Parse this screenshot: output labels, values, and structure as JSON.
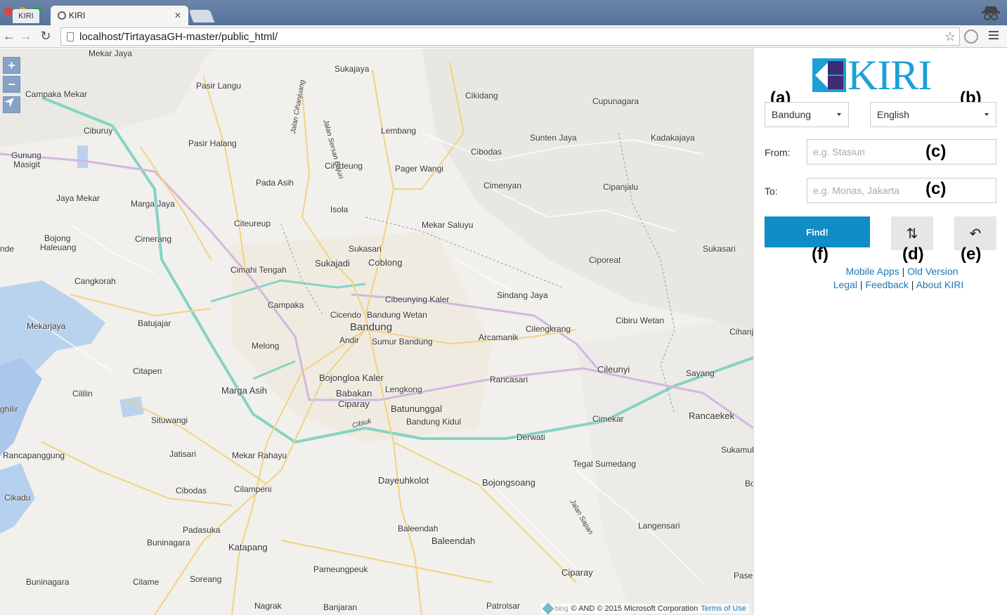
{
  "browser": {
    "small_tab_label": "KIRI",
    "active_tab_title": "KIRI",
    "close_glyph": "✕",
    "url": "localhost/TirtayasaGH-master/public_html/",
    "back_glyph": "←",
    "forward_glyph": "→",
    "reload_glyph": "↻",
    "star_glyph": "☆"
  },
  "map": {
    "zoom_in": "+",
    "zoom_out": "−",
    "locate_icon": "navigation-arrow",
    "labels": [
      {
        "text": "Mekar Jaya",
        "cls": ""
      },
      {
        "text": "Sukajaya",
        "cls": ""
      },
      {
        "text": "Pasir Langu",
        "cls": ""
      },
      {
        "text": "Cikidang",
        "cls": ""
      },
      {
        "text": "Cupunagara",
        "cls": ""
      },
      {
        "text": "Campaka Mekar",
        "cls": ""
      },
      {
        "text": "Ciburuy",
        "cls": ""
      },
      {
        "text": "Lembang",
        "cls": ""
      },
      {
        "text": "Sunten Jaya",
        "cls": ""
      },
      {
        "text": "Kadakajaya",
        "cls": ""
      },
      {
        "text": "Pasir Halang",
        "cls": ""
      },
      {
        "text": "Gunung",
        "cls": ""
      },
      {
        "text": "Masigit",
        "cls": ""
      },
      {
        "text": "Cibodas",
        "cls": ""
      },
      {
        "text": "Cihideung",
        "cls": ""
      },
      {
        "text": "Pager Wangi",
        "cls": ""
      },
      {
        "text": "Pada Asih",
        "cls": ""
      },
      {
        "text": "Cimenyan",
        "cls": ""
      },
      {
        "text": "Cipanjalu",
        "cls": ""
      },
      {
        "text": "Jaya Mekar",
        "cls": ""
      },
      {
        "text": "Marga Jaya",
        "cls": ""
      },
      {
        "text": "Isola",
        "cls": ""
      },
      {
        "text": "Citeureup",
        "cls": ""
      },
      {
        "text": "Mekar Saluyu",
        "cls": ""
      },
      {
        "text": "Bojong",
        "cls": ""
      },
      {
        "text": "Haleuang",
        "cls": ""
      },
      {
        "text": "Cimerang",
        "cls": ""
      },
      {
        "text": "nde",
        "cls": ""
      },
      {
        "text": "Sukasari",
        "cls": ""
      },
      {
        "text": "Sukajadi",
        "cls": "mid"
      },
      {
        "text": "Coblong",
        "cls": "mid"
      },
      {
        "text": "Cimahi Tengah",
        "cls": ""
      },
      {
        "text": "Ciporeat",
        "cls": ""
      },
      {
        "text": "Sukasari",
        "cls": ""
      },
      {
        "text": "Cangkorah",
        "cls": ""
      },
      {
        "text": "Sindang Jaya",
        "cls": ""
      },
      {
        "text": "Cibeunying Kaler",
        "cls": ""
      },
      {
        "text": "Campaka",
        "cls": ""
      },
      {
        "text": "Cicendo",
        "cls": ""
      },
      {
        "text": "Bandung Wetan",
        "cls": ""
      },
      {
        "text": "Cibiru Wetan",
        "cls": ""
      },
      {
        "text": "Mekarjaya",
        "cls": ""
      },
      {
        "text": "Batujajar",
        "cls": ""
      },
      {
        "text": "Bandung",
        "cls": "major"
      },
      {
        "text": "Cilengkrang",
        "cls": ""
      },
      {
        "text": "Cihanj",
        "cls": ""
      },
      {
        "text": "Andir",
        "cls": ""
      },
      {
        "text": "Sumur Bandung",
        "cls": ""
      },
      {
        "text": "Arcamanik",
        "cls": ""
      },
      {
        "text": "Melong",
        "cls": ""
      },
      {
        "text": "Cileunyi",
        "cls": "mid"
      },
      {
        "text": "Citapen",
        "cls": ""
      },
      {
        "text": "Sayang",
        "cls": ""
      },
      {
        "text": "Bojongloa Kaler",
        "cls": "mid"
      },
      {
        "text": "Rancasari",
        "cls": ""
      },
      {
        "text": "Marga Asih",
        "cls": "mid"
      },
      {
        "text": "Lengkong",
        "cls": ""
      },
      {
        "text": "Babakan",
        "cls": "mid"
      },
      {
        "text": "Cililin",
        "cls": ""
      },
      {
        "text": "Ciparay",
        "cls": "mid"
      },
      {
        "text": "Batununggal",
        "cls": "mid"
      },
      {
        "text": "ghilir",
        "cls": ""
      },
      {
        "text": "Cimekar",
        "cls": ""
      },
      {
        "text": "Rancaekek",
        "cls": "mid"
      },
      {
        "text": "Situwangi",
        "cls": ""
      },
      {
        "text": "Bandung Kidul",
        "cls": ""
      },
      {
        "text": "Derwati",
        "cls": ""
      },
      {
        "text": "Sukamul",
        "cls": ""
      },
      {
        "text": "Rancapanggung",
        "cls": ""
      },
      {
        "text": "Jatisari",
        "cls": ""
      },
      {
        "text": "Mekar Rahayu",
        "cls": ""
      },
      {
        "text": "Tegal Sumedang",
        "cls": ""
      },
      {
        "text": "Dayeuhkolot",
        "cls": "mid"
      },
      {
        "text": "Bojongsoang",
        "cls": "mid"
      },
      {
        "text": "Bo",
        "cls": ""
      },
      {
        "text": "Cikadu",
        "cls": ""
      },
      {
        "text": "Cibodas",
        "cls": ""
      },
      {
        "text": "Cilampeni",
        "cls": ""
      },
      {
        "text": "Langensari",
        "cls": ""
      },
      {
        "text": "Padasuka",
        "cls": ""
      },
      {
        "text": "Baleendah",
        "cls": ""
      },
      {
        "text": "Buninagara",
        "cls": ""
      },
      {
        "text": "Baleendah",
        "cls": "mid"
      },
      {
        "text": "Katapang",
        "cls": "mid"
      },
      {
        "text": "Pameungpeuk",
        "cls": ""
      },
      {
        "text": "Ciparay",
        "cls": "mid"
      },
      {
        "text": "Buninagara",
        "cls": ""
      },
      {
        "text": "Cilame",
        "cls": ""
      },
      {
        "text": "Soreang",
        "cls": ""
      },
      {
        "text": "Paseh",
        "cls": ""
      },
      {
        "text": "Nagrak",
        "cls": ""
      },
      {
        "text": "Banjaran",
        "cls": ""
      },
      {
        "text": "Patrolsar",
        "cls": ""
      },
      {
        "text": "Jalan Cihanjuang",
        "cls": ""
      },
      {
        "text": "Jalan Sersan Bajuri",
        "cls": ""
      },
      {
        "text": "Jalan Sapan",
        "cls": ""
      },
      {
        "text": "Cibiuk",
        "cls": ""
      }
    ],
    "attribution": {
      "bing": "bing",
      "text": "© AND © 2015 Microsoft Corporation",
      "link": "Terms of Use"
    }
  },
  "panel": {
    "logo_text": "KIRI",
    "annotations": {
      "a": "(a)",
      "b": "(b)",
      "c1": "(c)",
      "c2": "(c)",
      "d": "(d)",
      "e": "(e)",
      "f": "(f)"
    },
    "city_select": "Bandung",
    "language_select": "English",
    "from_label": "From:",
    "from_placeholder": "e.g. Stasiun",
    "to_label": "To:",
    "to_placeholder": "e.g. Monas, Jakarta",
    "find_label": "Find!",
    "swap_glyph": "⇅",
    "reset_glyph": "↶",
    "links": {
      "mobile_apps": "Mobile Apps",
      "old_version": "Old Version",
      "legal": "Legal",
      "feedback": "Feedback",
      "about": "About KIRI",
      "sep": "|"
    }
  }
}
